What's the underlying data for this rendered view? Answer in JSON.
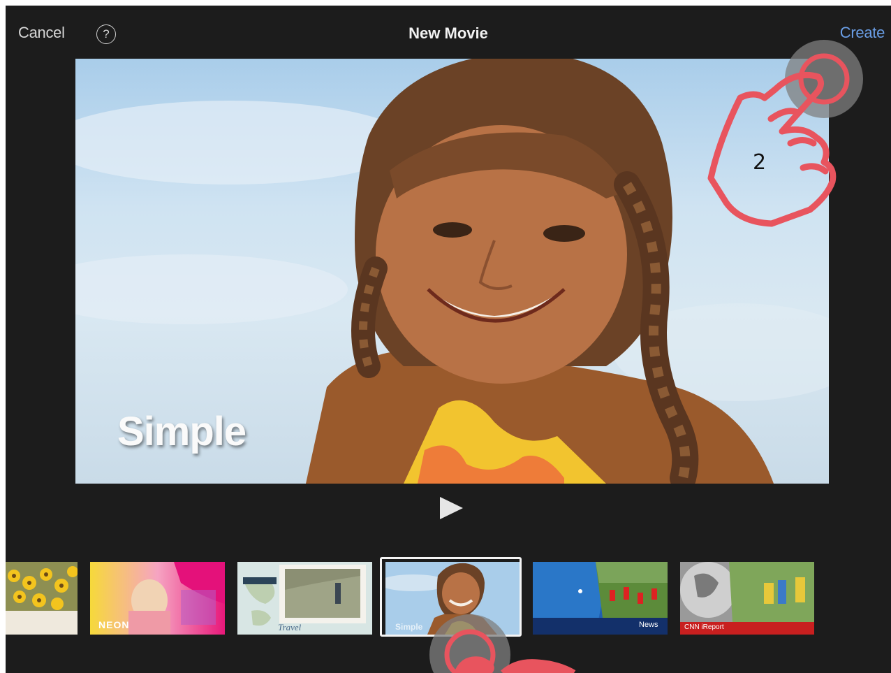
{
  "window": {
    "title": "New Movie",
    "cancel_label": "Cancel",
    "help_icon_glyph": "?",
    "create_label": "Create"
  },
  "preview": {
    "theme_title": "Simple"
  },
  "themes": [
    {
      "name": "",
      "selected": false
    },
    {
      "name": "NEON",
      "selected": false
    },
    {
      "name": "Travel",
      "selected": false
    },
    {
      "name": "Simple",
      "selected": true
    },
    {
      "name": "News",
      "selected": false
    },
    {
      "name": "CNN iReport",
      "selected": false
    }
  ],
  "annotations": {
    "step_number": "2"
  },
  "colors": {
    "background": "#1c1c1c",
    "accent": "#6a9ee6",
    "annotation": "#e8545e"
  }
}
